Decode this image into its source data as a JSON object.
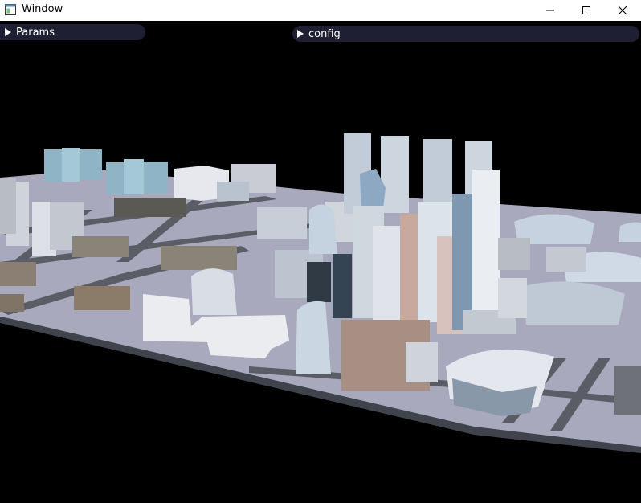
{
  "window": {
    "title": "Window",
    "app_icon": "window-app-icon",
    "buttons": {
      "minimize": "minimize-icon",
      "maximize": "maximize-icon",
      "close": "close-icon"
    }
  },
  "panels": {
    "params": {
      "label": "Params",
      "collapsed": true,
      "icon": "triangle-right-icon"
    },
    "config": {
      "label": "config",
      "collapsed": true,
      "icon": "triangle-right-icon"
    }
  },
  "colors": {
    "titlebar_bg": "#ffffff",
    "viewport_bg": "#000000",
    "header_bg": "#1f1f33",
    "ground": "#a9a9bd",
    "road": "#55575f"
  }
}
